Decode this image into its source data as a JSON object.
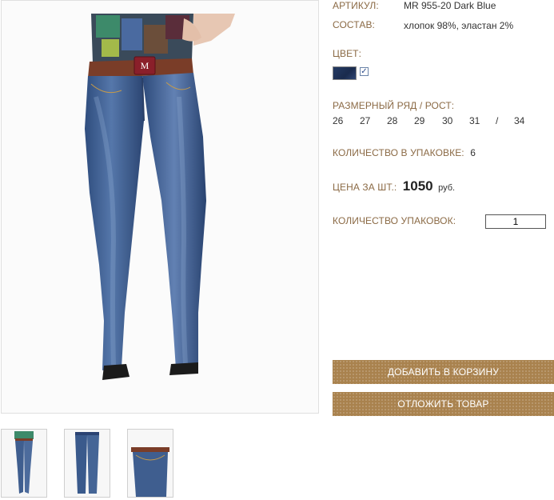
{
  "product": {
    "article_label": "АРТИКУЛ:",
    "article_value": "MR 955-20 Dark Blue",
    "composition_label": "СОСТАВ:",
    "composition_value": "хлопок 98%, эластан 2%",
    "color_label": "ЦВЕТ:",
    "color_swatch": "#1f3358",
    "size_label": "РАЗМЕРНЫЙ РЯД / РОСТ:",
    "sizes": [
      "26",
      "27",
      "28",
      "29",
      "30",
      "31",
      "/",
      "34"
    ],
    "pack_label": "КОЛИЧЕСТВО В УПАКОВКЕ:",
    "pack_value": "6",
    "price_label": "ЦЕНА ЗА ШТ.:",
    "price_value": "1050",
    "price_unit": "руб.",
    "qty_label": "КОЛИЧЕСТВО УПАКОВОК:",
    "qty_value": "1"
  },
  "buttons": {
    "add_to_cart": "ДОБАВИТЬ В КОРЗИНУ",
    "postpone": "ОТЛОЖИТЬ ТОВАР"
  },
  "colors": {
    "label": "#8b6a45",
    "button": "#a9824e",
    "denim": "#3f5e8f"
  },
  "belt_logo": "M"
}
